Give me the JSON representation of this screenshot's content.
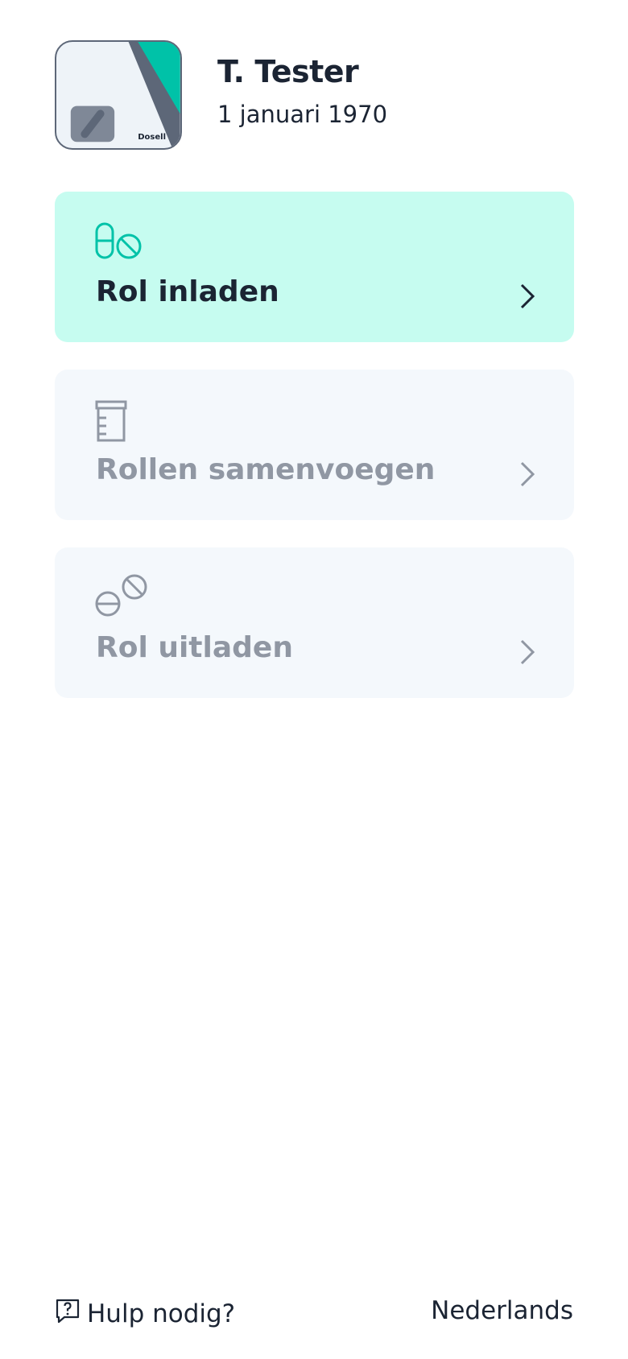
{
  "profile": {
    "name": "T. Tester",
    "dob": "1 januari 1970",
    "device_brand": "Dosell"
  },
  "actions": [
    {
      "label": "Rol inladen",
      "icon": "pill-load-icon",
      "state": "active"
    },
    {
      "label": "Rollen samenvoegen",
      "icon": "roll-merge-icon",
      "state": "disabled"
    },
    {
      "label": "Rol uitladen",
      "icon": "pill-unload-icon",
      "state": "disabled"
    }
  ],
  "footer": {
    "help_label": "Hulp nodig?",
    "help_icon": "help-chat-icon",
    "language": "Nederlands"
  },
  "colors": {
    "accent": "#00c2a8",
    "active_bg": "#c6fcf0",
    "disabled_bg": "#f4f8fc",
    "text": "#1b2433",
    "muted": "#9097a3"
  }
}
